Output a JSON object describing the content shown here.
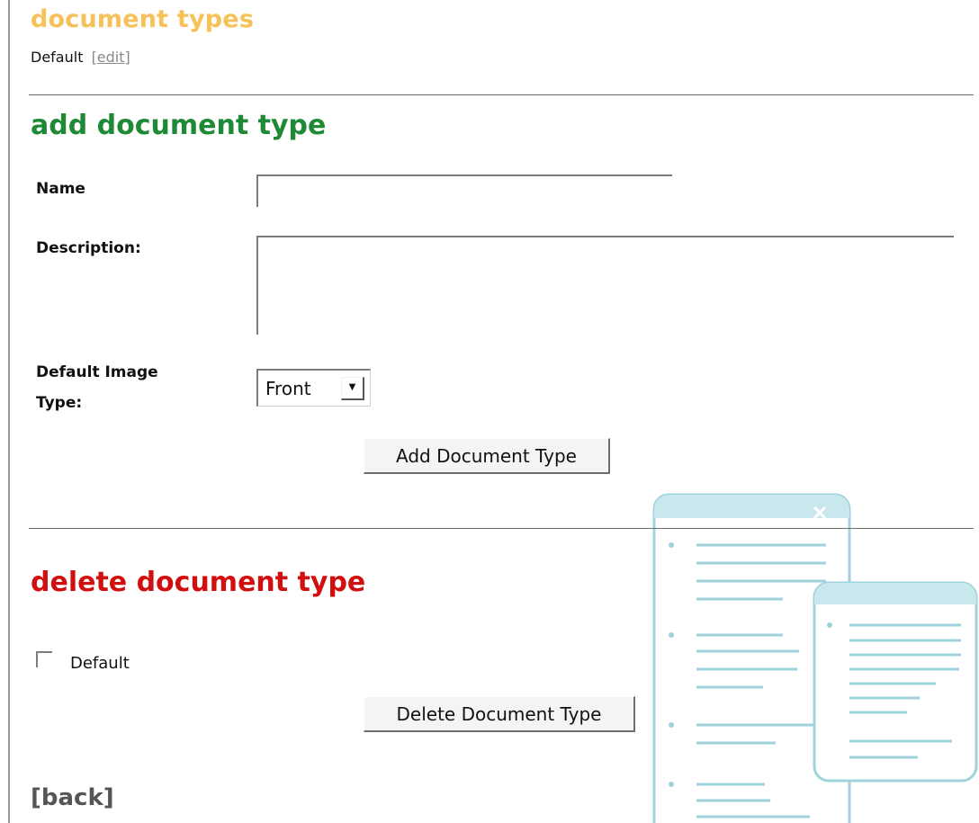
{
  "document_types": {
    "heading": "document types",
    "items": [
      {
        "name": "Default",
        "edit_label": "[edit]"
      }
    ]
  },
  "add_section": {
    "heading": "add document type",
    "name_label": "Name",
    "name_value": "",
    "description_label": "Description:",
    "description_value": "",
    "image_type_label_line1": "Default Image",
    "image_type_label_line2": "Type:",
    "image_type_selected": "Front",
    "submit_label": "Add Document Type"
  },
  "delete_section": {
    "heading": "delete document type",
    "checkbox_label": "Default",
    "checkbox_checked": false,
    "submit_label": "Delete Document Type"
  },
  "back_label": "[back]",
  "colors": {
    "types_heading": "#f5c158",
    "add_heading": "#1f8a35",
    "delete_heading": "#d20f0f",
    "illustration_stroke": "#9fd3dc",
    "illustration_fill": "#eaf6f8"
  }
}
